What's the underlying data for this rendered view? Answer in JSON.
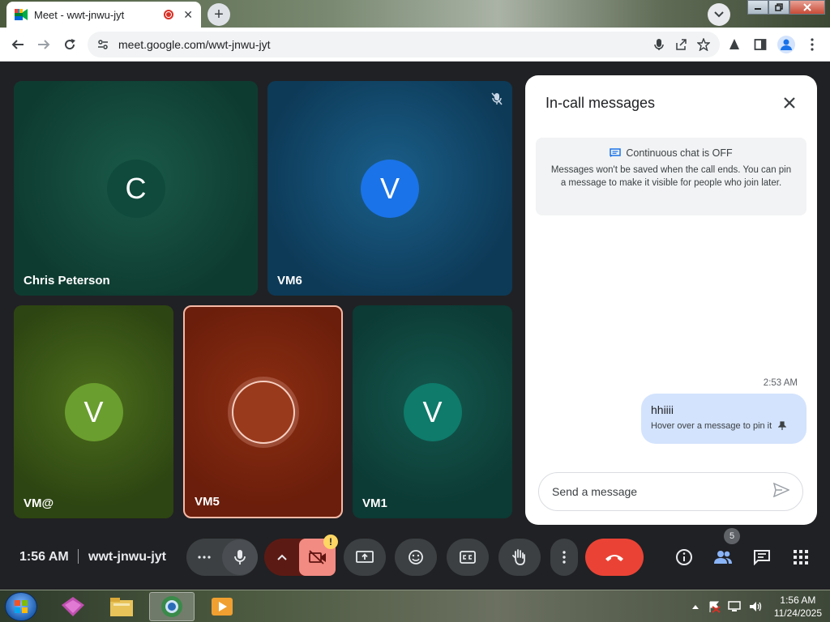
{
  "browser": {
    "tab_title": "Meet - wwt-jnwu-jyt",
    "url": "meet.google.com/wwt-jnwu-jyt",
    "tab_close": "✕",
    "new_tab": "+"
  },
  "meet": {
    "time": "1:56 AM",
    "meeting_code": "wwt-jnwu-jyt",
    "participants_count": "5",
    "alert_badge": "!",
    "tiles": [
      {
        "initial": "C",
        "name": "Chris Peterson",
        "avatar_color": "#0f4a3c",
        "muted": false
      },
      {
        "initial": "V",
        "name": "VM6",
        "avatar_color": "#1a73e8",
        "muted": true
      },
      {
        "initial": "V",
        "name": "VM@",
        "avatar_color": "#6a9e2e",
        "muted": false
      },
      {
        "initial": "",
        "name": "VM5",
        "avatar_color": "#9a3a1c",
        "muted": false
      },
      {
        "initial": "V",
        "name": "VM1",
        "avatar_color": "#0e7b6b",
        "muted": false
      }
    ]
  },
  "chat": {
    "title": "In-call messages",
    "notice_title": "Continuous chat is OFF",
    "notice_body": "Messages won't be saved when the call ends. You can pin a message to make it visible for people who join later.",
    "message_time": "2:53 AM",
    "message_text": "hhiiii",
    "message_hint": "Hover over a message to pin it",
    "input_placeholder": "Send a message"
  },
  "taskbar": {
    "time": "1:56 AM",
    "date": "11/24/2025"
  },
  "colors": {
    "end_call": "#ea4335",
    "active_speaker_border": "#f6b9a6",
    "bubble": "#d3e3fd",
    "camera_off": "#f28b82"
  }
}
